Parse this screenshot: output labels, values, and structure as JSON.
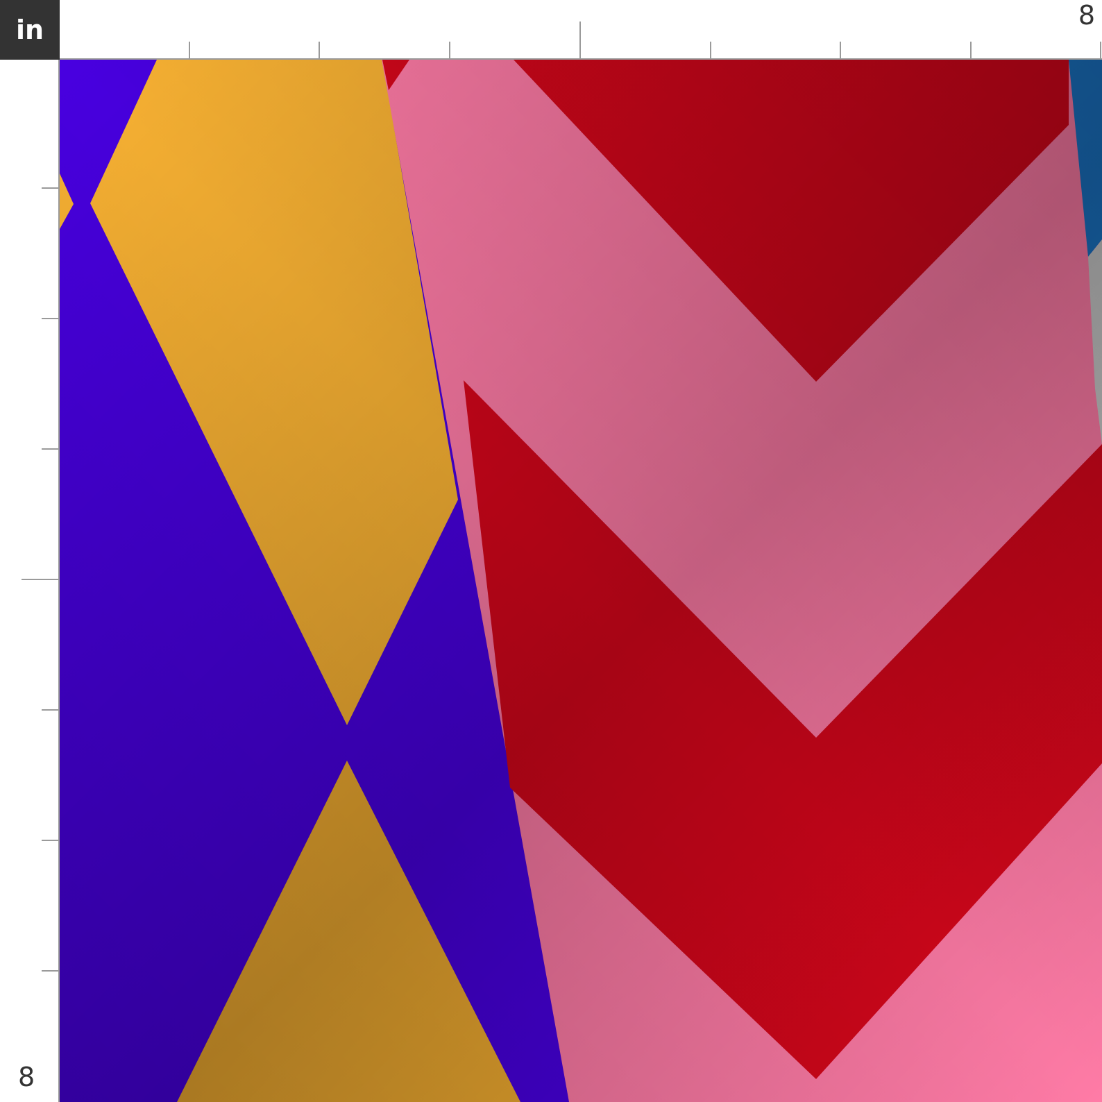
{
  "ruler": {
    "unit_label": "in",
    "top_max_label": "8",
    "left_max_label": "8",
    "tick_color": "#9a9a9a",
    "badge_color": "#333333"
  },
  "swatch": {
    "colors": {
      "purple": "#4800e0",
      "orange": "#f9b233",
      "pink": "#ff7ba6",
      "red": "#d6061b",
      "blue": "#1a73c4",
      "gray": "#c8c8c8"
    }
  }
}
